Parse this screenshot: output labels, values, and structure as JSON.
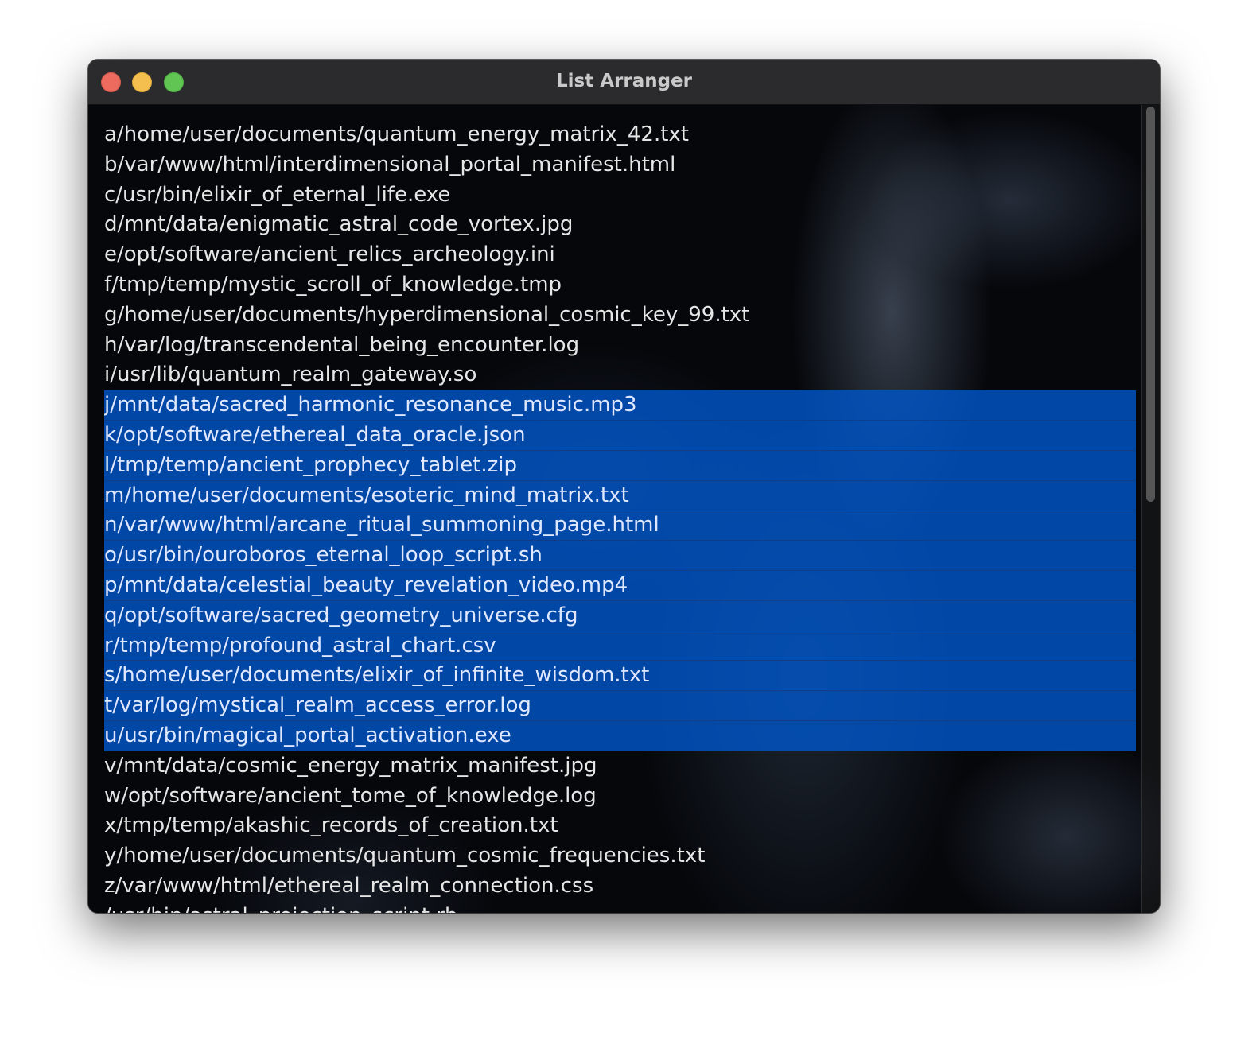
{
  "window": {
    "title": "List Arranger"
  },
  "list": {
    "items": [
      {
        "text": "a/home/user/documents/quantum_energy_matrix_42.txt",
        "selected": false
      },
      {
        "text": "b/var/www/html/interdimensional_portal_manifest.html",
        "selected": false
      },
      {
        "text": "c/usr/bin/elixir_of_eternal_life.exe",
        "selected": false
      },
      {
        "text": "d/mnt/data/enigmatic_astral_code_vortex.jpg",
        "selected": false
      },
      {
        "text": "e/opt/software/ancient_relics_archeology.ini",
        "selected": false
      },
      {
        "text": "f/tmp/temp/mystic_scroll_of_knowledge.tmp",
        "selected": false
      },
      {
        "text": "g/home/user/documents/hyperdimensional_cosmic_key_99.txt",
        "selected": false
      },
      {
        "text": "h/var/log/transcendental_being_encounter.log",
        "selected": false
      },
      {
        "text": "i/usr/lib/quantum_realm_gateway.so",
        "selected": false
      },
      {
        "text": "j/mnt/data/sacred_harmonic_resonance_music.mp3",
        "selected": true
      },
      {
        "text": "k/opt/software/ethereal_data_oracle.json",
        "selected": true
      },
      {
        "text": "l/tmp/temp/ancient_prophecy_tablet.zip",
        "selected": true
      },
      {
        "text": "m/home/user/documents/esoteric_mind_matrix.txt",
        "selected": true
      },
      {
        "text": "n/var/www/html/arcane_ritual_summoning_page.html",
        "selected": true
      },
      {
        "text": "o/usr/bin/ouroboros_eternal_loop_script.sh",
        "selected": true
      },
      {
        "text": "p/mnt/data/celestial_beauty_revelation_video.mp4",
        "selected": true
      },
      {
        "text": "q/opt/software/sacred_geometry_universe.cfg",
        "selected": true
      },
      {
        "text": "r/tmp/temp/profound_astral_chart.csv",
        "selected": true
      },
      {
        "text": "s/home/user/documents/elixir_of_infinite_wisdom.txt",
        "selected": true
      },
      {
        "text": "t/var/log/mystical_realm_access_error.log",
        "selected": true
      },
      {
        "text": "u/usr/bin/magical_portal_activation.exe",
        "selected": true
      },
      {
        "text": "v/mnt/data/cosmic_energy_matrix_manifest.jpg",
        "selected": false
      },
      {
        "text": "w/opt/software/ancient_tome_of_knowledge.log",
        "selected": false
      },
      {
        "text": "x/tmp/temp/akashic_records_of_creation.txt",
        "selected": false
      },
      {
        "text": "y/home/user/documents/quantum_cosmic_frequencies.txt",
        "selected": false
      },
      {
        "text": "z/var/www/html/ethereal_realm_connection.css",
        "selected": false
      },
      {
        "text": "/usr/bin/astral_projection_script.rb",
        "selected": false
      }
    ]
  },
  "colors": {
    "selection": "#0055c8",
    "text": "#e6e6e6",
    "background": "#05070b",
    "titlebar": "#2b2b2d"
  },
  "icons": [
    "close-button",
    "minimize-button",
    "zoom-button"
  ]
}
